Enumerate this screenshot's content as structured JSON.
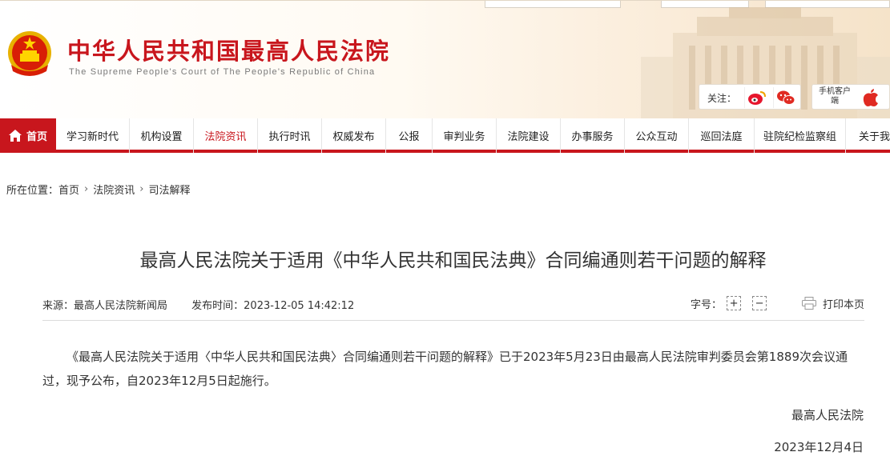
{
  "header": {
    "site_title": "中华人民共和国最高人民法院",
    "site_subtitle": "The Supreme People's Court of The People's Republic of China",
    "follow_label": "关注：",
    "app_label": "手机客户端",
    "brand_color": "#c8161d"
  },
  "nav": {
    "items": [
      {
        "label": "首页",
        "icon": "home-icon"
      },
      {
        "label": "学习新时代"
      },
      {
        "label": "机构设置"
      },
      {
        "label": "法院资讯"
      },
      {
        "label": "执行时讯"
      },
      {
        "label": "权威发布"
      },
      {
        "label": "公报"
      },
      {
        "label": "审判业务"
      },
      {
        "label": "法院建设"
      },
      {
        "label": "办事服务"
      },
      {
        "label": "公众互动"
      },
      {
        "label": "巡回法庭"
      },
      {
        "label": "驻院纪检监察组"
      },
      {
        "label": "关于我们"
      }
    ],
    "active_label": "法院资讯"
  },
  "breadcrumb": {
    "prefix": "所在位置：",
    "items": [
      "首页",
      "法院资讯",
      "司法解释"
    ]
  },
  "article": {
    "title": "最高人民法院关于适用《中华人民共和国民法典》合同编通则若干问题的解释",
    "source": "来源：最高人民法院新闻局",
    "published": "发布时间：2023-12-05 14:42:12",
    "font_size_label": "字号：",
    "font_increase": "+",
    "font_decrease": "−",
    "print_label": "打印本页",
    "body": "《最高人民法院关于适用〈中华人民共和国民法典〉合同编通则若干问题的解释》已于2023年5月23日由最高人民法院审判委员会第1889次会议通过，现予公布，自2023年12月5日起施行。",
    "signature_org": "最高人民法院",
    "signature_date": "2023年12月4日"
  }
}
